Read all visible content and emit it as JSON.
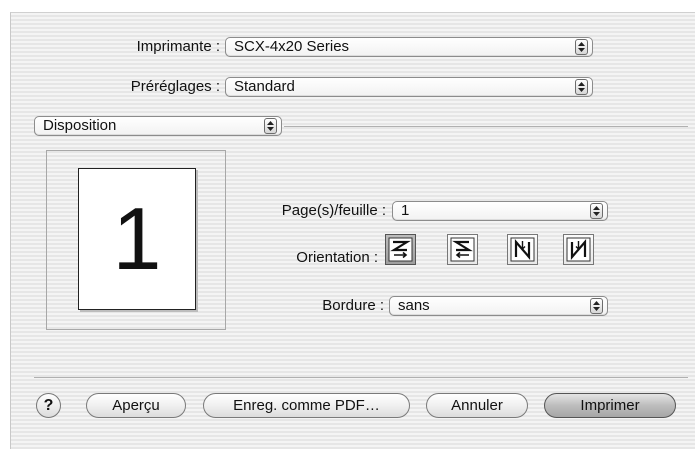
{
  "printer": {
    "label": "Imprimante :",
    "value": "SCX-4x20 Series"
  },
  "presets": {
    "label": "Préréglages :",
    "value": "Standard"
  },
  "panel": {
    "value": "Disposition"
  },
  "preview": {
    "page_number": "1"
  },
  "layout": {
    "pages_label": "Page(s)/feuille :",
    "pages_value": "1",
    "orientation_label": "Orientation :",
    "orientation_icons": [
      "z-order-icon",
      "reverse-z-order-icon",
      "n-order-icon",
      "reverse-n-order-icon"
    ],
    "selected_orientation": 0,
    "border_label": "Bordure :",
    "border_value": "sans"
  },
  "buttons": {
    "help": "?",
    "preview": "Aperçu",
    "save_pdf": "Enreg. comme PDF…",
    "cancel": "Annuler",
    "print": "Imprimer"
  }
}
